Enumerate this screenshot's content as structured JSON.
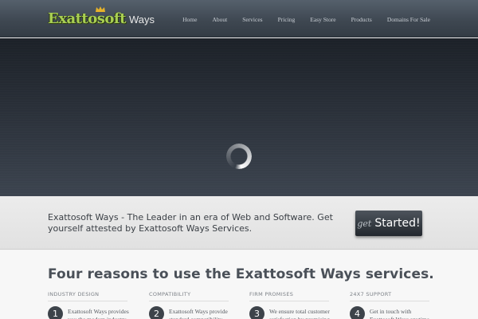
{
  "header": {
    "logo_brand": "Exattosoft",
    "logo_suffix": "Ways",
    "nav": [
      "Home",
      "About",
      "Services",
      "Pricing",
      "Easy Store",
      "Products",
      "Domains For Sale"
    ]
  },
  "hero": {
    "loading_icon": "spinner-icon"
  },
  "cta": {
    "text": "Exattosoft Ways - The Leader in an era of Web and Software. Get yourself attested by Exattosoft Ways Services.",
    "button_small": "get",
    "button_big": "Started!"
  },
  "reasons": {
    "title": "Four reasons to use the Exattosoft Ways services.",
    "columns": [
      {
        "heading": "INDUSTRY DESIGN",
        "number": "1",
        "text": "Exattosoft Ways provides you the modern industry"
      },
      {
        "heading": "COMPATIBILITY",
        "number": "2",
        "text": "Exattosoft Ways provide standard compatibility"
      },
      {
        "heading": "FIRM PROMISES",
        "number": "3",
        "text": "We ensure total customer satisfaction by promising"
      },
      {
        "heading": "24X7 SUPPORT",
        "number": "4",
        "text": "Get in touch with Exattosoft Ways anytime"
      }
    ]
  },
  "colors": {
    "brand_green": "#a9cf53",
    "header_bg": "#3f4852",
    "hero_bg": "#2a3039",
    "button_bg": "#23282e"
  }
}
